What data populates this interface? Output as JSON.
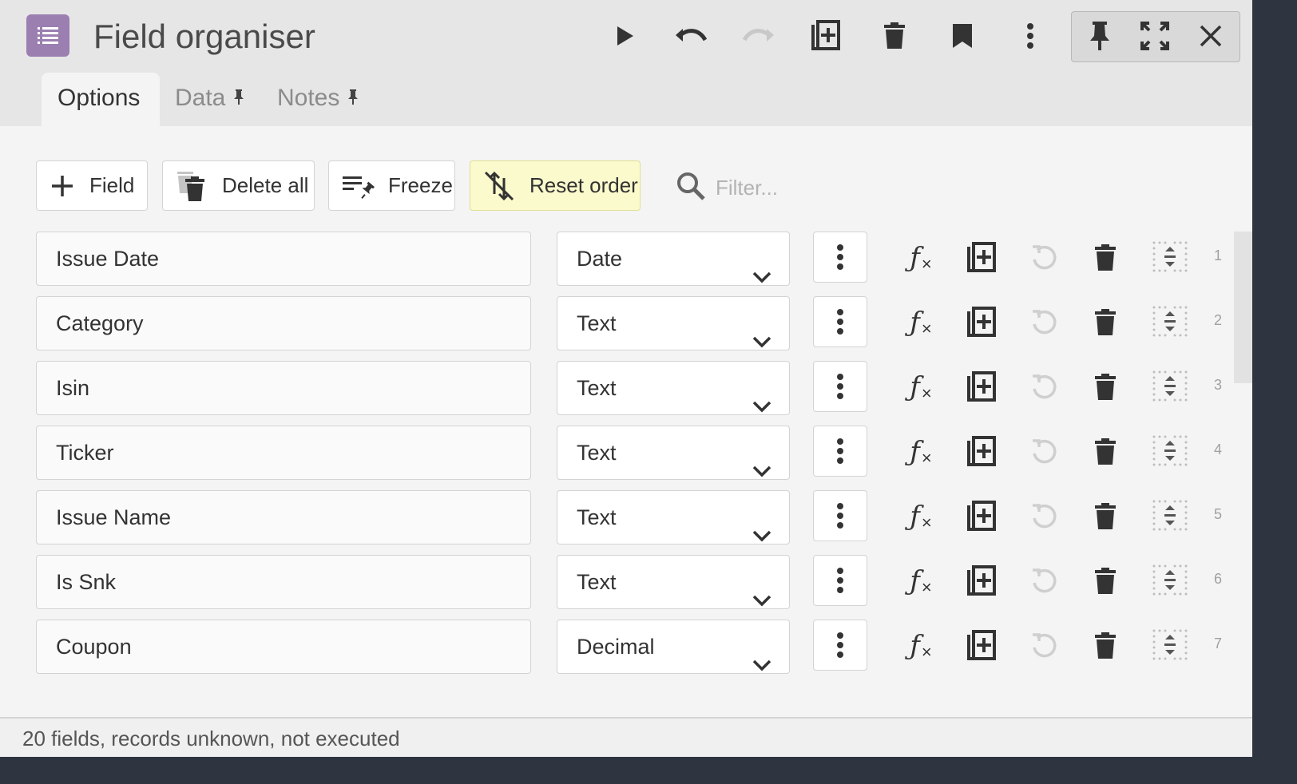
{
  "window": {
    "title": "Field organiser",
    "app_icon": "list-icon",
    "accent_color": "#9b7fb1"
  },
  "titlebar_actions": [
    {
      "name": "run",
      "icon": "play-icon"
    },
    {
      "name": "undo",
      "icon": "undo-icon"
    },
    {
      "name": "redo",
      "icon": "redo-icon",
      "disabled": true
    },
    {
      "name": "duplicate",
      "icon": "duplicate-icon"
    },
    {
      "name": "delete",
      "icon": "trash-icon"
    },
    {
      "name": "bookmark",
      "icon": "bookmark-icon"
    },
    {
      "name": "more",
      "icon": "more-vertical-icon"
    },
    {
      "name": "pin",
      "icon": "pin-icon"
    },
    {
      "name": "maximize",
      "icon": "expand-icon"
    },
    {
      "name": "close",
      "icon": "close-icon"
    }
  ],
  "tabs": [
    {
      "label": "Options",
      "active": true
    },
    {
      "label": "Data",
      "pinned": true
    },
    {
      "label": "Notes",
      "pinned": true
    }
  ],
  "toolbar": {
    "add_field_label": "Field",
    "delete_all_label": "Delete all",
    "freeze_label": "Freeze",
    "reset_order_label": "Reset order",
    "filter_placeholder": "Filter..."
  },
  "fields": [
    {
      "name": "Issue Date",
      "type": "Date",
      "index": "1"
    },
    {
      "name": "Category",
      "type": "Text",
      "index": "2"
    },
    {
      "name": "Isin",
      "type": "Text",
      "index": "3"
    },
    {
      "name": "Ticker",
      "type": "Text",
      "index": "4"
    },
    {
      "name": "Issue Name",
      "type": "Text",
      "index": "5"
    },
    {
      "name": "Is Snk",
      "type": "Text",
      "index": "6"
    },
    {
      "name": "Coupon",
      "type": "Decimal",
      "index": "7"
    }
  ],
  "row_icons": {
    "formula": "formula-icon",
    "formula_label": "ƒ",
    "formula_sub": "×",
    "duplicate": "duplicate-icon",
    "reset": "reset-icon",
    "delete": "trash-icon",
    "drag": "drag-handle-icon"
  },
  "status": "20 fields, records unknown, not executed"
}
